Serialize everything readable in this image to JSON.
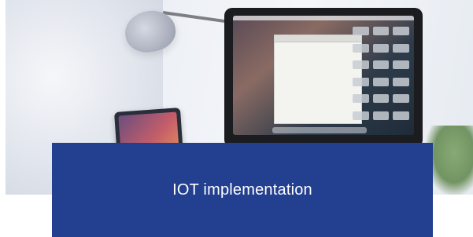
{
  "card": {
    "title": "IOT implementation",
    "caption_bg": "#233f8f",
    "caption_text_color": "#ffffff",
    "image_subject": "desk-with-monitor-lamp-and-tablet"
  }
}
